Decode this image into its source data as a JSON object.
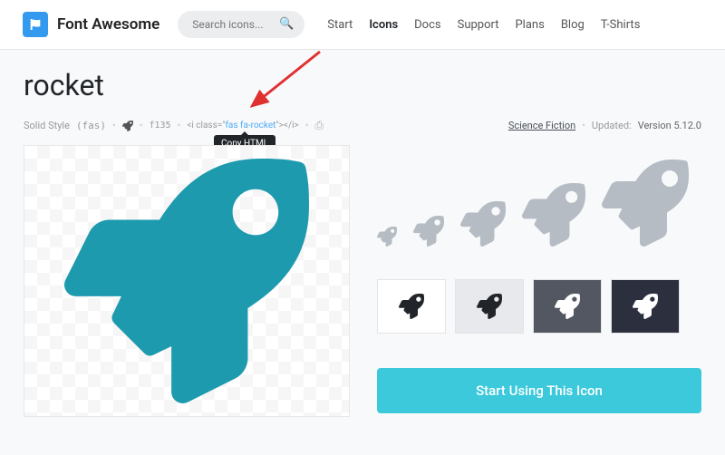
{
  "header": {
    "brand": "Font Awesome",
    "search_placeholder": "Search icons...",
    "nav": {
      "start": "Start",
      "icons": "Icons",
      "docs": "Docs",
      "support": "Support",
      "plans": "Plans",
      "blog": "Blog",
      "tshirts": "T-Shirts"
    }
  },
  "page": {
    "title": "rocket",
    "style_label": "Solid Style",
    "style_code": "(fas)",
    "unicode": "f135",
    "html_prefix": "<i class=\"",
    "html_class": "fas fa-rocket",
    "html_suffix": "\"></i>",
    "tooltip": "Copy HTML",
    "category_link": "Science Fiction",
    "updated_label": "Updated:",
    "version": "Version 5.12.0",
    "cta": "Start Using This Icon"
  },
  "colors": {
    "brand": "#339af0",
    "preview_fill": "#1e9aae",
    "size_fill": "#b5bcc3",
    "cta_bg": "#3bc9db"
  }
}
